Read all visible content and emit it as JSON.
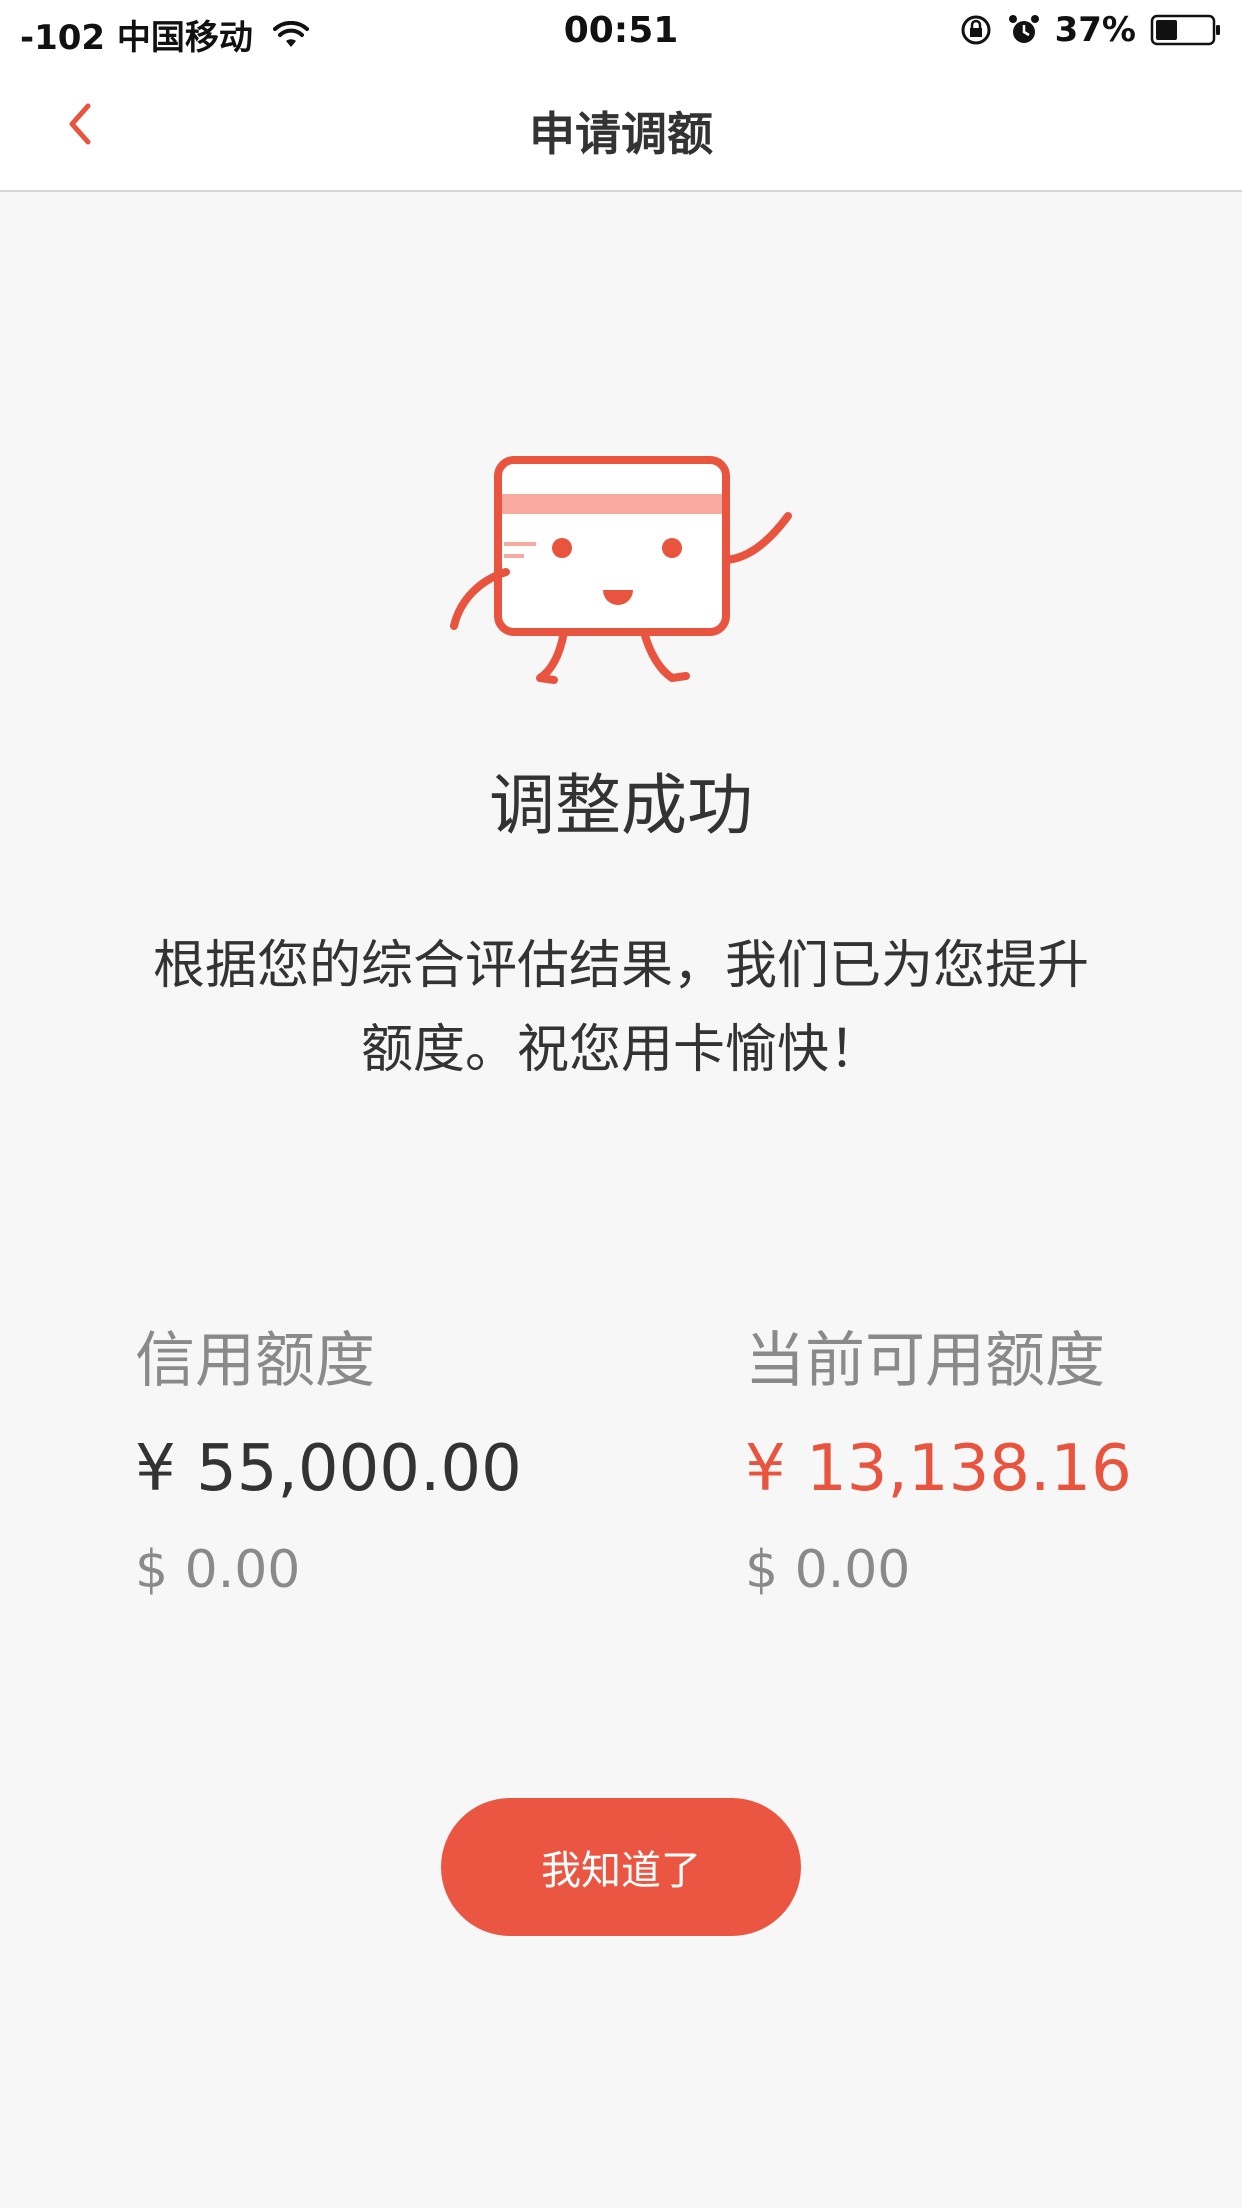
{
  "status_bar": {
    "carrier": "-102 中国移动",
    "time": "00:51",
    "battery": "37%"
  },
  "nav": {
    "title": "申请调额"
  },
  "result": {
    "title": "调整成功",
    "description": "根据您的综合评估结果，我们已为您提升额度。祝您用卡愉快！"
  },
  "credit_limit": {
    "label": "信用额度",
    "cny": "¥ 55,000.00",
    "usd": "$ 0.00"
  },
  "available_limit": {
    "label": "当前可用额度",
    "cny": "¥ 13,138.16",
    "usd": "$ 0.00"
  },
  "button": {
    "label": "我知道了"
  },
  "colors": {
    "accent": "#eb5642",
    "text_primary": "#333333",
    "text_secondary": "#8a8a8a",
    "background": "#f7f7f7"
  },
  "icons": {
    "wifi": "wifi-icon",
    "lock": "rotation-lock-icon",
    "alarm": "alarm-icon",
    "battery": "battery-icon",
    "back": "chevron-left-icon",
    "mascot": "card-mascot-icon"
  }
}
